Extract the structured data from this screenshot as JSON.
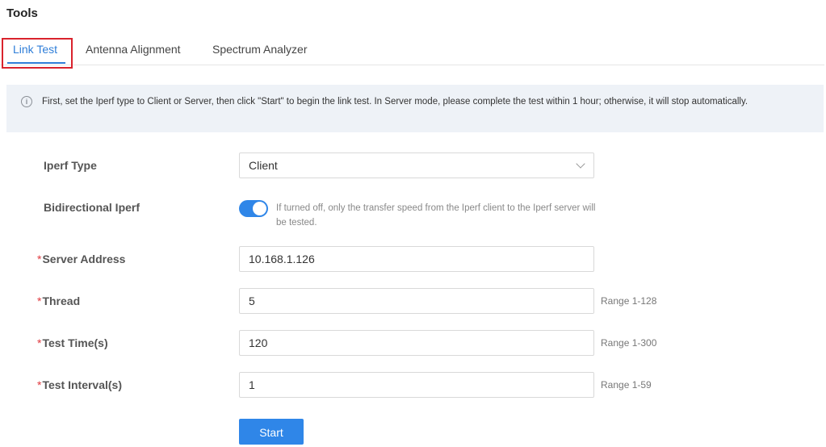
{
  "page": {
    "title": "Tools"
  },
  "tabs": [
    {
      "label": "Link Test",
      "active": true
    },
    {
      "label": "Antenna Alignment",
      "active": false
    },
    {
      "label": "Spectrum Analyzer",
      "active": false
    }
  ],
  "notice": {
    "icon": "info-icon",
    "text": "First, set the Iperf type to Client or Server, then click \"Start\" to begin the link test. In Server mode, please complete the test within 1 hour; otherwise, it will stop automatically."
  },
  "form": {
    "iperf_type": {
      "label": "Iperf Type",
      "value": "Client"
    },
    "bidirectional": {
      "label": "Bidirectional Iperf",
      "enabled": true,
      "hint": "If turned off, only the transfer speed from the Iperf client to the Iperf server will be tested."
    },
    "server_address": {
      "label": "Server Address",
      "required_mark": "*",
      "value": "10.168.1.126"
    },
    "thread": {
      "label": "Thread",
      "required_mark": "*",
      "value": "5",
      "range": "Range 1-128"
    },
    "test_time": {
      "label": "Test Time(s)",
      "required_mark": "*",
      "value": "120",
      "range": "Range 1-300"
    },
    "test_interval": {
      "label": "Test Interval(s)",
      "required_mark": "*",
      "value": "1",
      "range": "Range 1-59"
    },
    "start_label": "Start"
  },
  "colors": {
    "accent": "#2f86e8",
    "highlight": "#d9232d",
    "required": "#e0393e"
  }
}
